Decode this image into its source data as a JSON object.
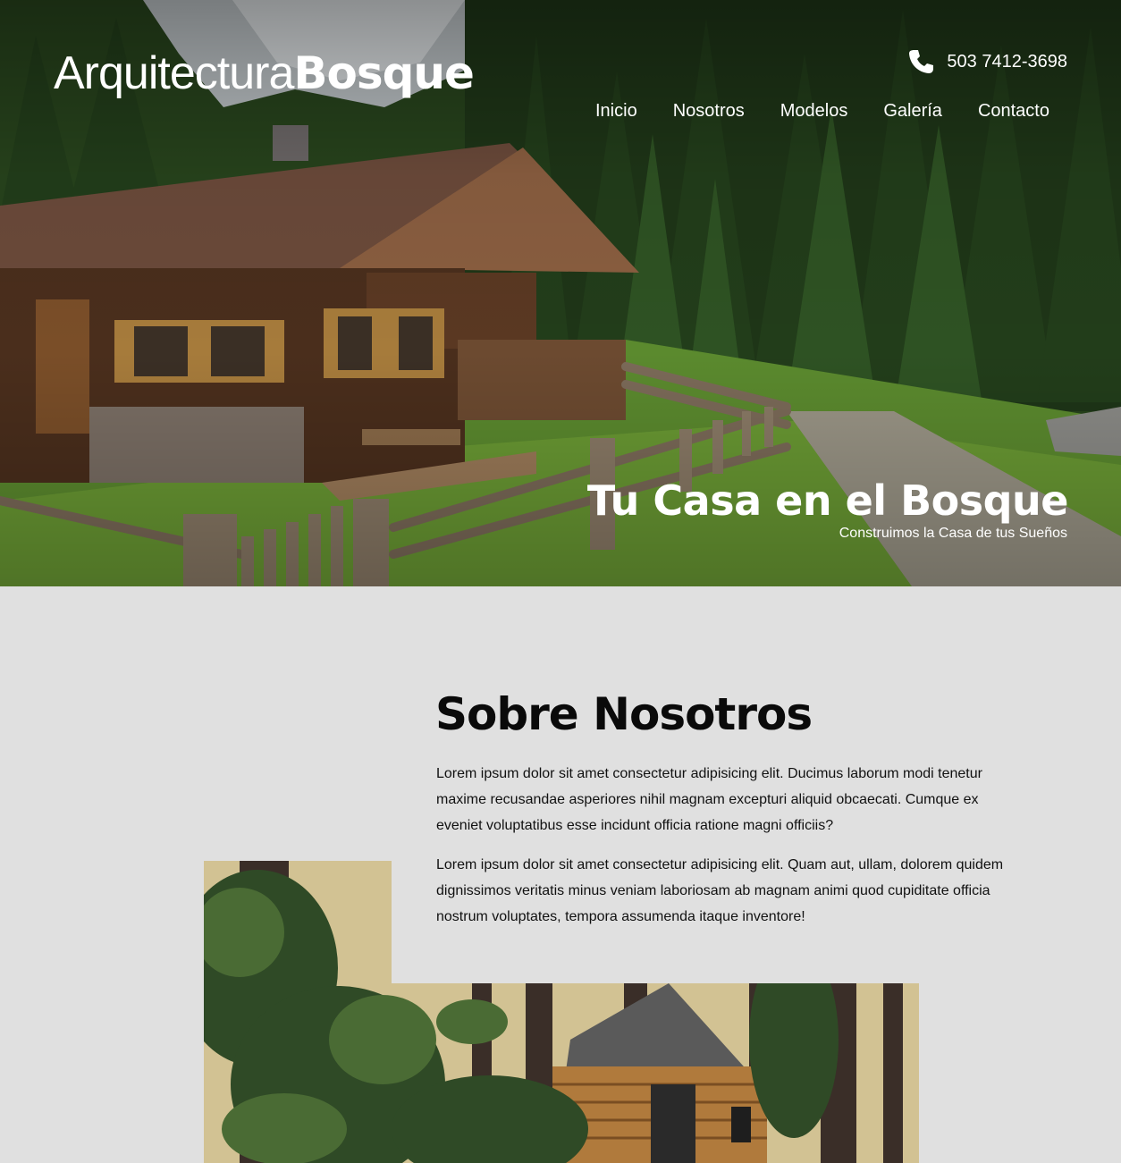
{
  "brand": {
    "light": "Arquitectura",
    "bold": "Bosque"
  },
  "header": {
    "phone": "503 7412-3698",
    "phone_icon": "phone-icon",
    "nav": [
      {
        "label": "Inicio"
      },
      {
        "label": "Nosotros"
      },
      {
        "label": "Modelos"
      },
      {
        "label": "Galería"
      },
      {
        "label": "Contacto"
      }
    ]
  },
  "hero": {
    "title": "Tu Casa en el Bosque",
    "subtitle": "Construimos la Casa de tus Sueños"
  },
  "about": {
    "title": "Sobre Nosotros",
    "paragraphs": [
      "Lorem ipsum dolor sit amet consectetur adipisicing elit. Ducimus laborum modi tenetur maxime recusandae asperiores nihil magnam excepturi aliquid obcaecati. Cumque ex eveniet voluptatibus esse incidunt officia ratione magni officiis?",
      "Lorem ipsum dolor sit amet consectetur adipisicing elit. Quam aut, ullam, dolorem quidem dignissimos veritatis minus veniam laboriosam ab magnam animi quod cupiditate officia nostrum voluptates, tempora assumenda itaque inventore!"
    ]
  },
  "colors": {
    "accent": "#ffffff",
    "section_bg": "#e0e0e0",
    "text": "#111111"
  }
}
